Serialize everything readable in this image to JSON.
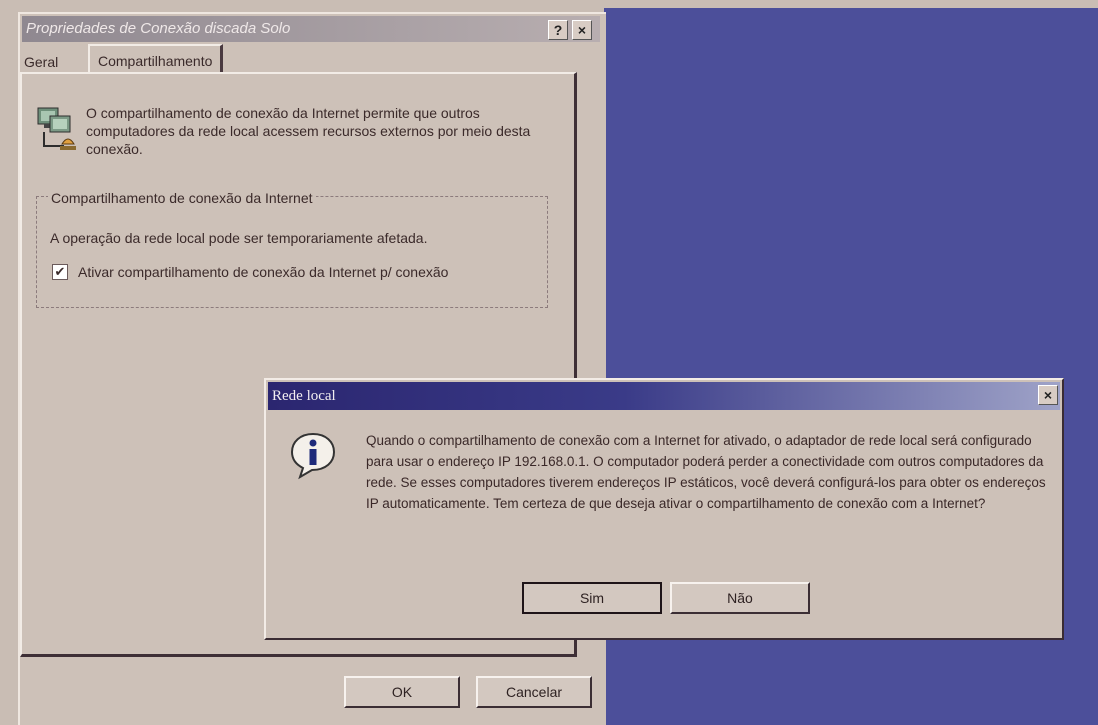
{
  "properties_window": {
    "title": "Propriedades de Conexão discada Solo",
    "help_button": "?",
    "close_button": "×",
    "tabs": [
      {
        "label": "Geral"
      },
      {
        "label": "Compartilhamento"
      }
    ],
    "intro_text": "O compartilhamento de conexão da Internet permite que outros computadores da rede local acessem recursos externos por meio desta conexão.",
    "group_title": "Compartilhamento de conexão da Internet",
    "group_text": "A operação da rede local pode ser temporariamente afetada.",
    "checkbox_label": "Ativar compartilhamento de conexão da Internet p/ conexão",
    "checkbox_checked": true,
    "ok_label": "OK",
    "cancel_label": "Cancelar"
  },
  "message_box": {
    "title": "Rede local",
    "close_button": "×",
    "icon": "information-icon",
    "text": "Quando o compartilhamento de conexão com a Internet for ativado, o adaptador de rede local será configurado para usar o endereço IP 192.168.0.1. O computador poderá perder a conectividade com outros computadores da rede. Se esses computadores tiverem endereços IP estáticos, você deverá configurá-los para obter os endereços IP automaticamente. Tem certeza de que deseja ativar o compartilhamento de conexão com a Internet?",
    "yes_label": "Sim",
    "no_label": "Não"
  },
  "colors": {
    "desktop": "#4c4f9a",
    "dialog_face": "#cdc1b8",
    "title_active": "#2b2670"
  }
}
